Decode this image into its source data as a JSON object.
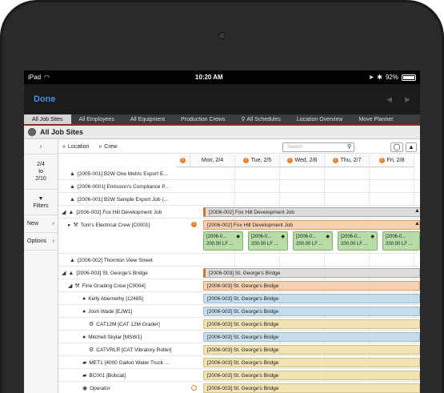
{
  "status": {
    "device": "iPad",
    "time": "10:20 AM",
    "battery": "92%",
    "battery_fraction": 0.92
  },
  "nav": {
    "done_label": "Done"
  },
  "tabs": [
    "All Job Sites",
    "All Employees",
    "All Equipment",
    "Production Crews",
    "All Schedules",
    "Location Overview",
    "Move Planner"
  ],
  "title": "All Job Sites",
  "left_nav": {
    "range_top": "2/4",
    "range_to": "to",
    "range_bottom": "2/10",
    "filters": "Filters",
    "new": "New",
    "options": "Options"
  },
  "filters": {
    "location": "Location",
    "crew": "Crew",
    "search_placeholder": "Search"
  },
  "days": [
    "Mon, 2/4",
    "Tue, 2/5",
    "Wed, 2/6",
    "Thu, 2/7",
    "Fri, 2/8"
  ],
  "rows": [
    {
      "label": "[2005-001] B2W One Metric Export E..."
    },
    {
      "label": "[2006-0001] Emission's Compliance P..."
    },
    {
      "label": "[2006-001] B2W Sample Export Job (..."
    },
    {
      "label": "[2006-002] Fox Hill Development Job",
      "bar": "[2006-002] Fox Hill Development Job"
    },
    {
      "label": "Tom's Electrical Crew [C0001]",
      "bar": "[2006-002] Fox Hill Development Job",
      "cells": [
        "[2006-0...",
        "200.00 LF ..."
      ]
    },
    {
      "label": "[2006-002] Thornton View Street"
    },
    {
      "label": "[2006-003] St. George's Bridge",
      "bar": "[2006-003] St. George's Bridge"
    },
    {
      "label": "Fine Grading Crew [C0004]",
      "bar": "[2006-003] St. George's Bridge"
    },
    {
      "label": "Kelly Abernethy [12485]",
      "bar": "[2006-003] St. George's Bridge"
    },
    {
      "label": "Josh Wade [EJW1]",
      "bar": "[2006-003] St. George's Bridge"
    },
    {
      "label": "CAT12M [CAT 12M Grader]",
      "bar": "[2006-003] St. George's Bridge"
    },
    {
      "label": "Mitchell Skylar [MSW1]",
      "bar": "[2006-003] St. George's Bridge"
    },
    {
      "label": "CATVRLR [CAT Vibratory Roller]",
      "bar": "[2006-003] St. George's Bridge"
    },
    {
      "label": "MET1 [4000 Gallon Water Truck ...",
      "bar": "[2006-003] St. George's Bridge"
    },
    {
      "label": "BC001 [Bobcat]",
      "bar": "[2006-003] St. George's Bridge"
    },
    {
      "label": "Operator",
      "bar": "[2006-003] St. George's Bridge"
    }
  ]
}
